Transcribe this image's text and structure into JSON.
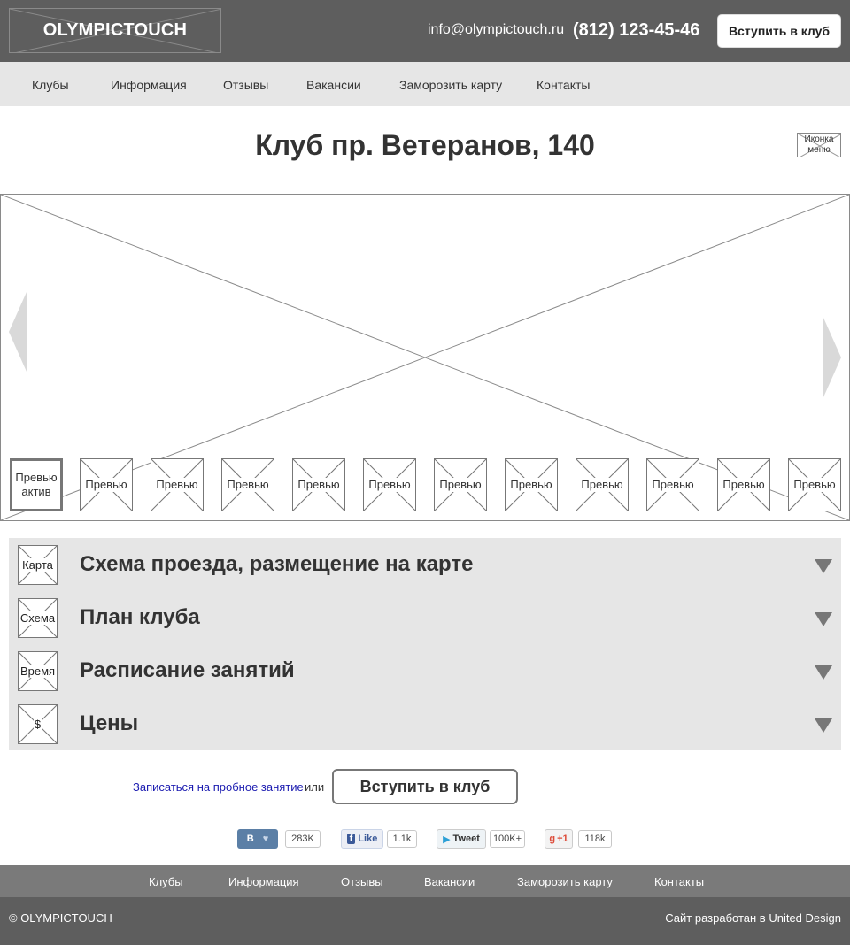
{
  "header": {
    "logo": "OLYMPICTOUCH",
    "email": "info@olympictouch.ru",
    "phone": "(812) 123-45-46",
    "join_button": "Вступить в клуб"
  },
  "nav": {
    "items": [
      "Клубы",
      "Информация",
      "Отзывы",
      "Вакансии",
      "Заморозить карту",
      "Контакты"
    ]
  },
  "page": {
    "title": "Клуб пр. Ветеранов, 140",
    "menu_icon_label": "Иконка меню"
  },
  "gallery": {
    "thumbnails": [
      {
        "label": "Превью актив",
        "active": true
      },
      {
        "label": "Превью",
        "active": false
      },
      {
        "label": "Превью",
        "active": false
      },
      {
        "label": "Превью",
        "active": false
      },
      {
        "label": "Превью",
        "active": false
      },
      {
        "label": "Превью",
        "active": false
      },
      {
        "label": "Превью",
        "active": false
      },
      {
        "label": "Превью",
        "active": false
      },
      {
        "label": "Превью",
        "active": false
      },
      {
        "label": "Превью",
        "active": false
      },
      {
        "label": "Превью",
        "active": false
      },
      {
        "label": "Превью",
        "active": false
      }
    ]
  },
  "accordion": {
    "items": [
      {
        "icon_label": "Карта",
        "title": "Схема проезда, размещение на карте"
      },
      {
        "icon_label": "Схема",
        "title": "План клуба"
      },
      {
        "icon_label": "Время",
        "title": "Расписание занятий"
      },
      {
        "icon_label": "$",
        "title": "Цены"
      }
    ]
  },
  "cta": {
    "link": "Записаться на пробное занятие",
    "or": "или",
    "button": "Вступить в клуб"
  },
  "social": {
    "vk": {
      "label": "В",
      "count": "283K"
    },
    "facebook": {
      "label": "Like",
      "count": "1.1k"
    },
    "twitter": {
      "label": "Tweet",
      "count": "100K+"
    },
    "google": {
      "label": "+1",
      "count": "118k"
    }
  },
  "footer_nav": {
    "items": [
      "Клубы",
      "Информация",
      "Отзывы",
      "Вакансии",
      "Заморозить карту",
      "Контакты"
    ]
  },
  "footer": {
    "copyright": "© OLYMPICTOUCH",
    "developer": "Сайт разработан в United Design"
  },
  "colors": {
    "header_bg": "#5e5e5e",
    "nav_bg": "#e6e6e6",
    "footer_nav_bg": "#7a7a7a",
    "link": "#1a1ab0",
    "vk": "#5b7fa6",
    "facebook": "#3b5998",
    "twitter": "#2a9fd6",
    "google": "#dd4b39"
  }
}
